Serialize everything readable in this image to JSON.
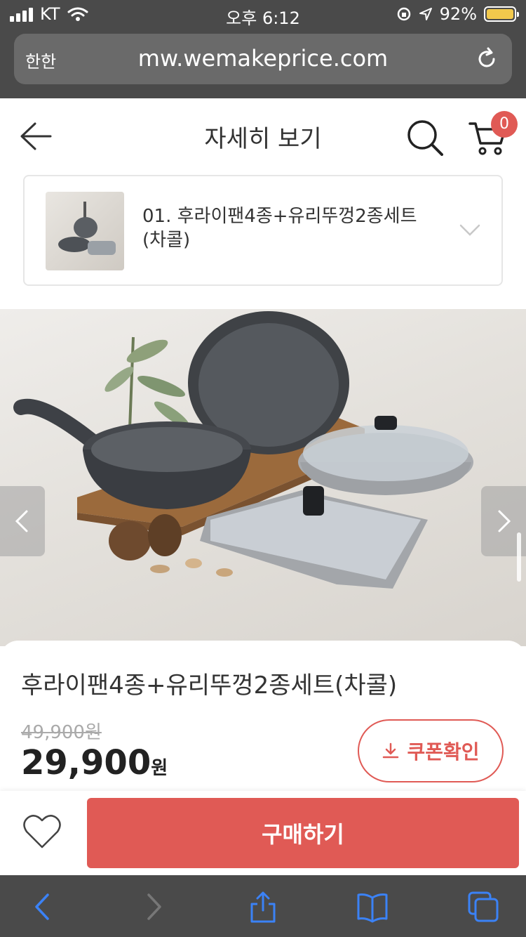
{
  "status": {
    "carrier": "KT",
    "time": "오후 6:12",
    "battery": "92%"
  },
  "browser": {
    "reader_label": "한한",
    "url": "mw.wemakeprice.com"
  },
  "header": {
    "title": "자세히 보기",
    "cart_count": "0"
  },
  "option": {
    "label": "01. 후라이팬4종+유리뚜껑2종세트(차콜)"
  },
  "product": {
    "name": "후라이팬4종+유리뚜껑2종세트(차콜)",
    "original_price": "49,900원",
    "price": "29,900",
    "price_unit": "원",
    "coupon_label": "쿠폰확인",
    "buy_label": "구매하기"
  },
  "colors": {
    "accent": "#e05a55",
    "browser_chrome": "#4a4a4a",
    "toolbar_icon": "#3b82f6"
  },
  "icons": {
    "back": "arrow-left-icon",
    "search": "search-icon",
    "cart": "cart-icon",
    "option_toggle": "chevron-down-icon",
    "carousel_prev": "chevron-left-icon",
    "carousel_next": "chevron-right-icon",
    "coupon": "download-icon",
    "wish": "heart-icon"
  }
}
